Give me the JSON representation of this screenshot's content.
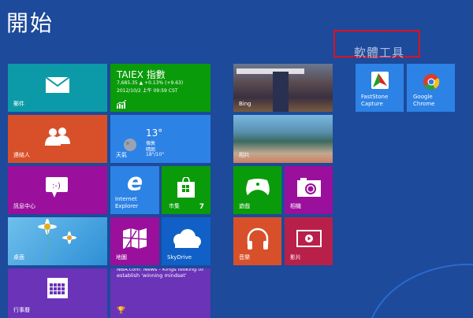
{
  "header": {
    "title": "開始"
  },
  "group_label": "軟體工具",
  "tiles": {
    "mail": {
      "label": "郵件"
    },
    "people": {
      "label": "連絡人"
    },
    "messaging": {
      "label": "訊息中心"
    },
    "desktop": {
      "label": "桌面"
    },
    "calendar": {
      "label": "行事曆"
    },
    "finance": {
      "title": "TAIEX 指數",
      "quote": "7,685.35 ▲ +0.13% (+9.63)",
      "time": "2012/10/2 上午 09:59 CST"
    },
    "weather": {
      "label": "天氣",
      "temp": "13°",
      "city": "倫敦",
      "condition": "晴朗",
      "range": "18°/10°"
    },
    "ie": {
      "label1": "Internet",
      "label2": "Explorer"
    },
    "store": {
      "label": "市集",
      "badge": "7"
    },
    "maps": {
      "label": "地圖"
    },
    "skydrive": {
      "label": "SkyDrive"
    },
    "sports": {
      "headline": "NBA.com: News - Kings looking to establish 'winning mindset'"
    },
    "bing": {
      "label": "Bing"
    },
    "photos": {
      "label": "相片"
    },
    "games": {
      "label": "遊戲"
    },
    "camera": {
      "label": "相機"
    },
    "music": {
      "label": "音樂"
    },
    "video": {
      "label": "影片"
    },
    "faststone": {
      "label1": "FastStone",
      "label2": "Capture"
    },
    "chrome": {
      "label": "Google Chrome"
    }
  },
  "colors": {
    "background": "#1d4a9a",
    "mail": "#0d9aa8",
    "finance": "#0a9b0a",
    "people": "#d8502a",
    "weather": "#2d82e6",
    "messaging": "#9a109c",
    "ie": "#2d82e6",
    "store": "#0a9b0a",
    "maps": "#9a109c",
    "skydrive": "#1060c8",
    "calendar": "#6a33b8",
    "sports": "#6a33b8",
    "games": "#0a9b0a",
    "camera": "#9a109c",
    "music": "#d8502a",
    "video": "#b8204a",
    "app": "#2d82e6",
    "highlight": "#e01020"
  }
}
